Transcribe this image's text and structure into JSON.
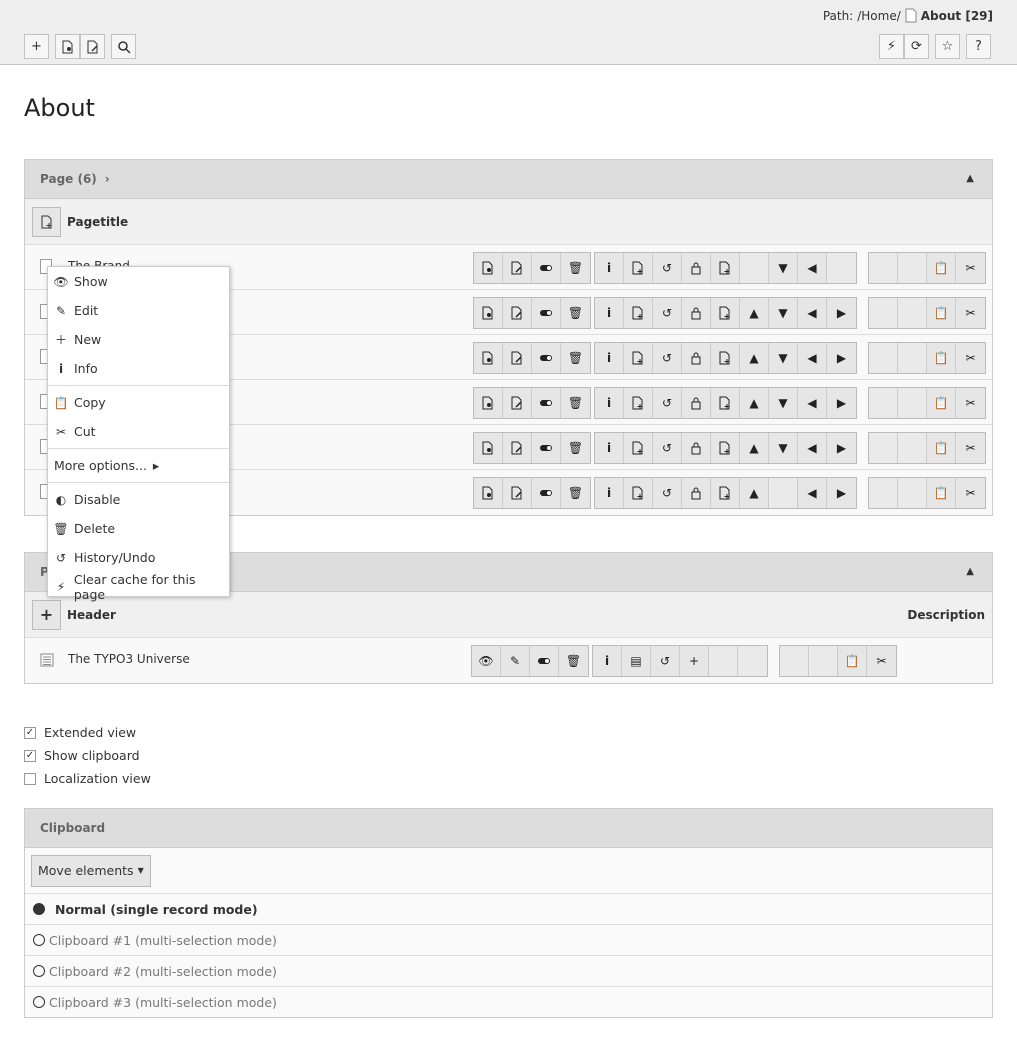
{
  "header": {
    "path_label": "Path:",
    "path_value": "/Home/",
    "page_label": "About [29]",
    "left_buttons": [
      "+",
      "view",
      "edit",
      "search"
    ],
    "right_buttons": [
      "clear-cache",
      "reload",
      "bookmark",
      "?"
    ]
  },
  "page_title": "About",
  "pages_panel": {
    "title": "Page (6)",
    "column": "Pagetitle",
    "rows": [
      {
        "title": "The Brand"
      },
      {
        "title": ""
      },
      {
        "title": ""
      },
      {
        "title": ""
      },
      {
        "title": ""
      },
      {
        "title": ""
      }
    ]
  },
  "content_panel": {
    "title": "P",
    "col_header": "Header",
    "col_description": "Description",
    "rows": [
      {
        "title": "The TYPO3 Universe"
      }
    ]
  },
  "context_menu": {
    "items": [
      {
        "icon": "show-icon",
        "label": "Show"
      },
      {
        "icon": "edit-icon",
        "label": "Edit"
      },
      {
        "icon": "new-icon",
        "label": "New"
      },
      {
        "icon": "info-icon",
        "label": "Info"
      },
      {
        "icon": "copy-icon",
        "label": "Copy"
      },
      {
        "icon": "cut-icon",
        "label": "Cut"
      },
      {
        "icon": "",
        "label": "More options..."
      },
      {
        "icon": "toggle-icon",
        "label": "Disable"
      },
      {
        "icon": "trash-icon",
        "label": "Delete"
      },
      {
        "icon": "history-icon",
        "label": "History/Undo"
      },
      {
        "icon": "bolt-icon",
        "label": "Clear cache for this page"
      }
    ]
  },
  "options": {
    "extended": "Extended view",
    "clipboard": "Show clipboard",
    "localization": "Localization view"
  },
  "clipboard": {
    "title": "Clipboard",
    "move_label": "Move elements",
    "modes": [
      "Normal (single record mode)",
      "Clipboard #1 (multi-selection mode)",
      "Clipboard #2 (multi-selection mode)",
      "Clipboard #3 (multi-selection mode)"
    ]
  }
}
